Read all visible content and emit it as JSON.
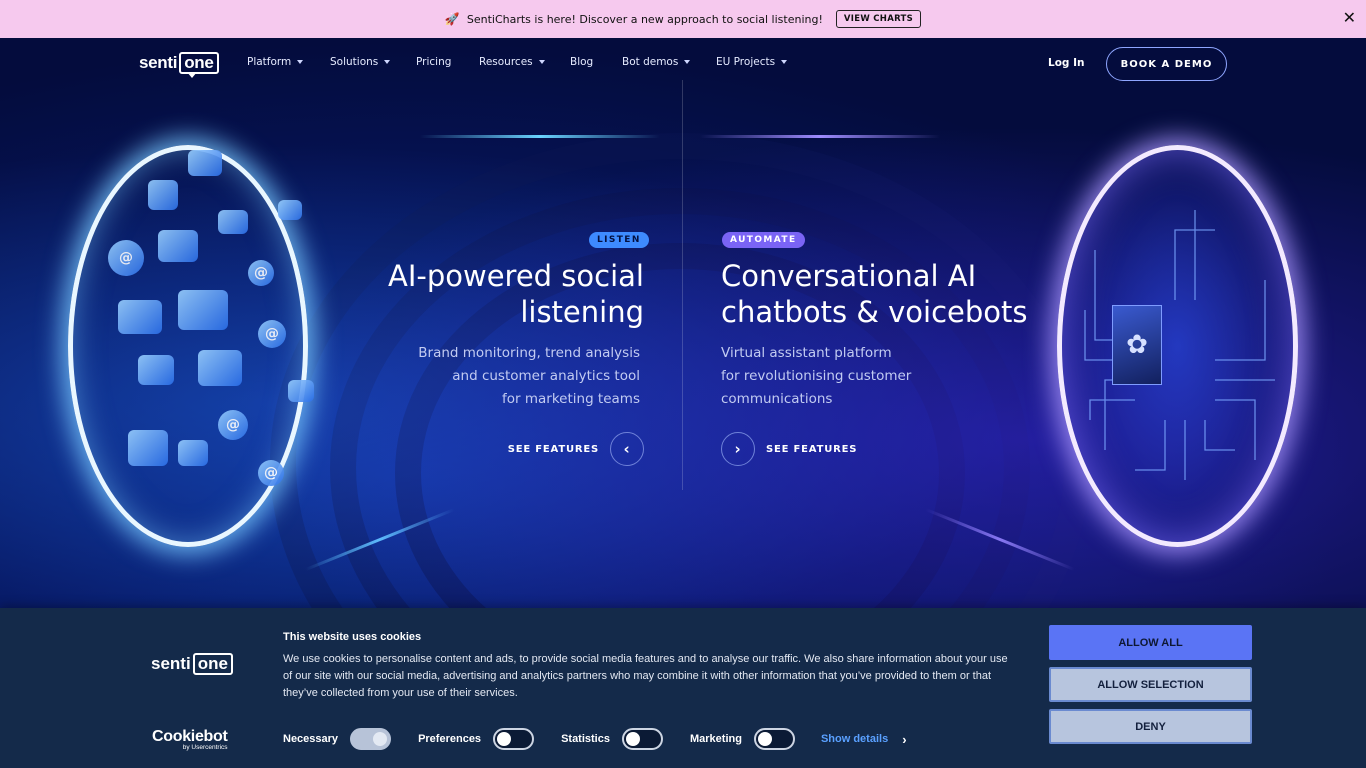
{
  "announcement": {
    "icon": "rocket-icon",
    "text": "SentiCharts is here! Discover a new approach to social listening!",
    "button_label": "VIEW CHARTS",
    "background": "#f6c9ee"
  },
  "nav": {
    "logo_left": "senti",
    "logo_right": "one",
    "items": [
      {
        "label": "Platform",
        "has_dropdown": true
      },
      {
        "label": "Solutions",
        "has_dropdown": true
      },
      {
        "label": "Pricing",
        "has_dropdown": false
      },
      {
        "label": "Resources",
        "has_dropdown": true
      },
      {
        "label": "Blog",
        "has_dropdown": false
      },
      {
        "label": "Bot demos",
        "has_dropdown": true
      },
      {
        "label": "EU Projects",
        "has_dropdown": true
      }
    ],
    "login_label": "Log In",
    "demo_label": "BOOK A DEMO"
  },
  "hero": {
    "left": {
      "tag": "LISTEN",
      "heading_line1": "AI-powered social",
      "heading_line2": "listening",
      "desc_line1": "Brand monitoring, trend analysis",
      "desc_line2": "and customer analytics tool",
      "desc_line3": "for marketing teams",
      "cta": "SEE FEATURES"
    },
    "right": {
      "tag": "AUTOMATE",
      "heading_line1": "Conversational AI",
      "heading_line2": "chatbots & voicebots",
      "desc_line1": "Virtual assistant platform",
      "desc_line2": "for revolutionising customer",
      "desc_line3": "communications",
      "cta": "SEE FEATURES"
    },
    "colors": {
      "listen_tag": "#3e8bff",
      "automate_tag": "#7a64f5",
      "background": "#050a3a"
    }
  },
  "cookie": {
    "logo_left": "senti",
    "logo_right": "one",
    "title": "This website uses cookies",
    "text": "We use cookies to personalise content and ads, to provide social media features and to analyse our traffic. We also share information about your use of our site with our social media, advertising and analytics partners who may combine it with other information that you’ve provided to them or that they’ve collected from your use of their services.",
    "brand": "Cookiebot",
    "brand_sub": "by Usercentrics",
    "toggles": [
      {
        "label": "Necessary",
        "on": true
      },
      {
        "label": "Preferences",
        "on": false
      },
      {
        "label": "Statistics",
        "on": false
      },
      {
        "label": "Marketing",
        "on": false
      }
    ],
    "show_details": "Show details",
    "buttons": {
      "allow_all": "ALLOW ALL",
      "allow_selection": "ALLOW SELECTION",
      "deny": "DENY"
    },
    "colors": {
      "background": "#142a4a",
      "allow_all": "#5a74f5",
      "link": "#5aa0ff"
    }
  }
}
